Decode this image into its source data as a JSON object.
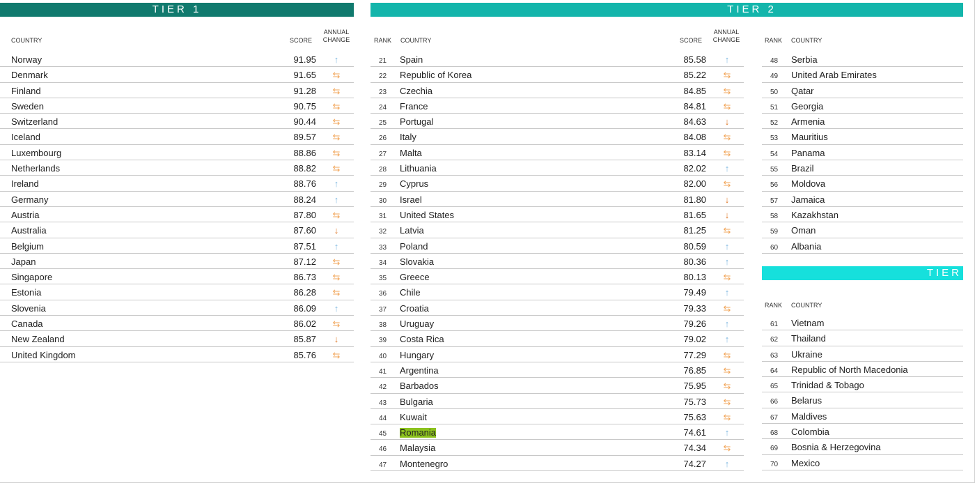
{
  "colors": {
    "tier1": "#117a6e",
    "tier2": "#13b5ab",
    "tier3": "#16e0dc",
    "highlight": "#8cc21e",
    "up": "#7fb8e0",
    "down": "#e07a2a",
    "same": "#f2a65a"
  },
  "headers": {
    "rank": "RANK",
    "country": "COUNTRY",
    "score": "SCORE",
    "annual": "ANNUAL",
    "change": "CHANGE"
  },
  "tier1": {
    "title": "TIER 1",
    "rows": [
      {
        "country": "Norway",
        "score": "91.95",
        "change": "up"
      },
      {
        "country": "Denmark",
        "score": "91.65",
        "change": "same"
      },
      {
        "country": "Finland",
        "score": "91.28",
        "change": "same"
      },
      {
        "country": "Sweden",
        "score": "90.75",
        "change": "same"
      },
      {
        "country": "Switzerland",
        "score": "90.44",
        "change": "same"
      },
      {
        "country": "Iceland",
        "score": "89.57",
        "change": "same"
      },
      {
        "country": "Luxembourg",
        "score": "88.86",
        "change": "same"
      },
      {
        "country": "Netherlands",
        "score": "88.82",
        "change": "same"
      },
      {
        "country": "Ireland",
        "score": "88.76",
        "change": "up"
      },
      {
        "country": "Germany",
        "score": "88.24",
        "change": "up"
      },
      {
        "country": "Austria",
        "score": "87.80",
        "change": "same"
      },
      {
        "country": "Australia",
        "score": "87.60",
        "change": "down"
      },
      {
        "country": "Belgium",
        "score": "87.51",
        "change": "up"
      },
      {
        "country": "Japan",
        "score": "87.12",
        "change": "same"
      },
      {
        "country": "Singapore",
        "score": "86.73",
        "change": "same"
      },
      {
        "country": "Estonia",
        "score": "86.28",
        "change": "same"
      },
      {
        "country": "Slovenia",
        "score": "86.09",
        "change": "up"
      },
      {
        "country": "Canada",
        "score": "86.02",
        "change": "same"
      },
      {
        "country": "New Zealand",
        "score": "85.87",
        "change": "down"
      },
      {
        "country": "United Kingdom",
        "score": "85.76",
        "change": "same"
      }
    ]
  },
  "tier2": {
    "title": "TIER 2",
    "rows": [
      {
        "rank": "21",
        "country": "Spain",
        "score": "85.58",
        "change": "up"
      },
      {
        "rank": "22",
        "country": "Republic of Korea",
        "score": "85.22",
        "change": "same"
      },
      {
        "rank": "23",
        "country": "Czechia",
        "score": "84.85",
        "change": "same"
      },
      {
        "rank": "24",
        "country": "France",
        "score": "84.81",
        "change": "same"
      },
      {
        "rank": "25",
        "country": "Portugal",
        "score": "84.63",
        "change": "down"
      },
      {
        "rank": "26",
        "country": "Italy",
        "score": "84.08",
        "change": "same"
      },
      {
        "rank": "27",
        "country": "Malta",
        "score": "83.14",
        "change": "same"
      },
      {
        "rank": "28",
        "country": "Lithuania",
        "score": "82.02",
        "change": "up"
      },
      {
        "rank": "29",
        "country": "Cyprus",
        "score": "82.00",
        "change": "same"
      },
      {
        "rank": "30",
        "country": "Israel",
        "score": "81.80",
        "change": "down"
      },
      {
        "rank": "31",
        "country": "United States",
        "score": "81.65",
        "change": "down"
      },
      {
        "rank": "32",
        "country": "Latvia",
        "score": "81.25",
        "change": "same"
      },
      {
        "rank": "33",
        "country": "Poland",
        "score": "80.59",
        "change": "up"
      },
      {
        "rank": "34",
        "country": "Slovakia",
        "score": "80.36",
        "change": "up"
      },
      {
        "rank": "35",
        "country": "Greece",
        "score": "80.13",
        "change": "same"
      },
      {
        "rank": "36",
        "country": "Chile",
        "score": "79.49",
        "change": "up"
      },
      {
        "rank": "37",
        "country": "Croatia",
        "score": "79.33",
        "change": "same"
      },
      {
        "rank": "38",
        "country": "Uruguay",
        "score": "79.26",
        "change": "up"
      },
      {
        "rank": "39",
        "country": "Costa Rica",
        "score": "79.02",
        "change": "up"
      },
      {
        "rank": "40",
        "country": "Hungary",
        "score": "77.29",
        "change": "same"
      },
      {
        "rank": "41",
        "country": "Argentina",
        "score": "76.85",
        "change": "same"
      },
      {
        "rank": "42",
        "country": "Barbados",
        "score": "75.95",
        "change": "same"
      },
      {
        "rank": "43",
        "country": "Bulgaria",
        "score": "75.73",
        "change": "same"
      },
      {
        "rank": "44",
        "country": "Kuwait",
        "score": "75.63",
        "change": "same"
      },
      {
        "rank": "45",
        "country": "Romania",
        "score": "74.61",
        "change": "up",
        "highlight": true
      },
      {
        "rank": "46",
        "country": "Malaysia",
        "score": "74.34",
        "change": "same"
      },
      {
        "rank": "47",
        "country": "Montenegro",
        "score": "74.27",
        "change": "up"
      }
    ],
    "rows_cont": [
      {
        "rank": "48",
        "country": "Serbia"
      },
      {
        "rank": "49",
        "country": "United Arab Emirates"
      },
      {
        "rank": "50",
        "country": "Qatar"
      },
      {
        "rank": "51",
        "country": "Georgia"
      },
      {
        "rank": "52",
        "country": "Armenia"
      },
      {
        "rank": "53",
        "country": "Mauritius"
      },
      {
        "rank": "54",
        "country": "Panama"
      },
      {
        "rank": "55",
        "country": "Brazil"
      },
      {
        "rank": "56",
        "country": "Moldova"
      },
      {
        "rank": "57",
        "country": "Jamaica"
      },
      {
        "rank": "58",
        "country": "Kazakhstan"
      },
      {
        "rank": "59",
        "country": "Oman"
      },
      {
        "rank": "60",
        "country": "Albania"
      }
    ]
  },
  "tier3": {
    "title": "TIER",
    "rows": [
      {
        "rank": "61",
        "country": "Vietnam"
      },
      {
        "rank": "62",
        "country": "Thailand"
      },
      {
        "rank": "63",
        "country": "Ukraine"
      },
      {
        "rank": "64",
        "country": "Republic of North Macedonia"
      },
      {
        "rank": "65",
        "country": "Trinidad & Tobago"
      },
      {
        "rank": "66",
        "country": "Belarus"
      },
      {
        "rank": "67",
        "country": "Maldives"
      },
      {
        "rank": "68",
        "country": "Colombia"
      },
      {
        "rank": "69",
        "country": "Bosnia & Herzegovina"
      },
      {
        "rank": "70",
        "country": "Mexico"
      }
    ]
  }
}
